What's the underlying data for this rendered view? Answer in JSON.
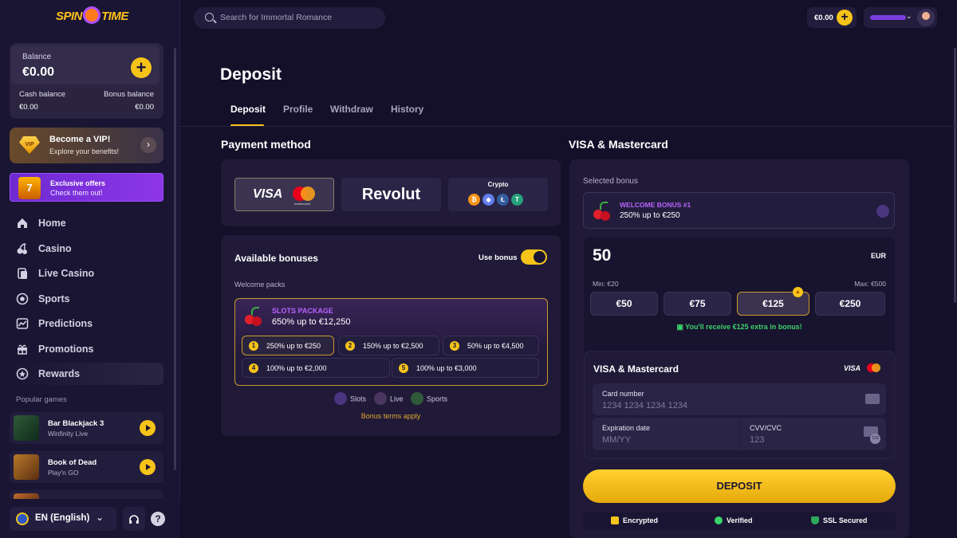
{
  "brand": {
    "logo_text_left": "SPIN",
    "logo_text_right": "TIME"
  },
  "sidebar": {
    "balance": {
      "label": "Balance",
      "value": "€0.00",
      "cash_label": "Cash balance",
      "cash_value": "€0.00",
      "bonus_label": "Bonus balance",
      "bonus_value": "€0.00"
    },
    "vip": {
      "badge": "VIP",
      "title": "Become a VIP!",
      "subtitle": "Explore your benefits!"
    },
    "offers": {
      "badge": "7",
      "title": "Exclusive offers",
      "subtitle": "Check them out!"
    },
    "nav": [
      {
        "label": "Home",
        "icon": "home-icon"
      },
      {
        "label": "Casino",
        "icon": "cherries-icon"
      },
      {
        "label": "Live Casino",
        "icon": "cards-icon"
      },
      {
        "label": "Sports",
        "icon": "ball-icon"
      },
      {
        "label": "Predictions",
        "icon": "chart-icon"
      },
      {
        "label": "Promotions",
        "icon": "gift-icon"
      },
      {
        "label": "Rewards",
        "icon": "star-badge-icon"
      }
    ],
    "popular_label": "Popular games",
    "games": [
      {
        "title": "Bar Blackjack 3",
        "provider": "Winfinity Live"
      },
      {
        "title": "Book of Dead",
        "provider": "Play'n GO"
      }
    ],
    "language": "EN (English)",
    "help": "?"
  },
  "topbar": {
    "search_placeholder": "Search for Immortal Romance",
    "balance": "€0.00"
  },
  "page": {
    "title": "Deposit",
    "tabs": [
      "Deposit",
      "Profile",
      "Withdraw",
      "History"
    ],
    "active_tab": "Deposit"
  },
  "payment": {
    "heading": "Payment method",
    "methods": {
      "visa": "VISA",
      "mastercard": "mastercard",
      "revolut": "Revolut",
      "crypto": "Crypto"
    },
    "crypto_coins": [
      "₿",
      "◆",
      "Ł",
      "T"
    ]
  },
  "bonuses": {
    "title": "Available bonuses",
    "use_bonus_label": "Use bonus",
    "use_bonus_on": true,
    "section_label": "Welcome packs",
    "package": {
      "title": "SLOTS PACKAGE",
      "subtitle": "650% up to €12,250"
    },
    "chips": [
      {
        "n": "1",
        "text": "250% up to €250"
      },
      {
        "n": "2",
        "text": "150% up to €2,500"
      },
      {
        "n": "3",
        "text": "50% up to €4,500"
      },
      {
        "n": "4",
        "text": "100% up to €2,000"
      },
      {
        "n": "5",
        "text": "100% up to €3,000"
      }
    ],
    "categories": [
      "Slots",
      "Live",
      "Sports"
    ],
    "terms": "Bonus terms apply"
  },
  "checkout": {
    "heading": "VISA & Mastercard",
    "selected_bonus_label": "Selected bonus",
    "selected_bonus": {
      "title": "WELCOME BONUS #1",
      "subtitle": "250% up to €250"
    },
    "amount": "50",
    "currency": "EUR",
    "min": "Min: €20",
    "max": "Max: €500",
    "presets": [
      "€50",
      "€75",
      "€125",
      "€250"
    ],
    "selected_preset": "€125",
    "extra_text": "You'll receive €125 extra in bonus!",
    "card": {
      "title": "VISA & Mastercard",
      "visa": "VISA",
      "number_label": "Card number",
      "number_placeholder": "1234 1234 1234 1234",
      "expiry_label": "Expiration date",
      "expiry_placeholder": "MM/YY",
      "cvv_label": "CVV/CVC",
      "cvv_placeholder": "123",
      "cvv_icon_text": "123"
    },
    "deposit_button": "DEPOSIT",
    "trust": [
      "Encrypted",
      "Verified",
      "SSL Secured"
    ]
  },
  "colors": {
    "accent": "#f6c319",
    "purple": "#b862ff",
    "bg": "#14102a",
    "panel": "#201a38",
    "success": "#3ad36a"
  }
}
